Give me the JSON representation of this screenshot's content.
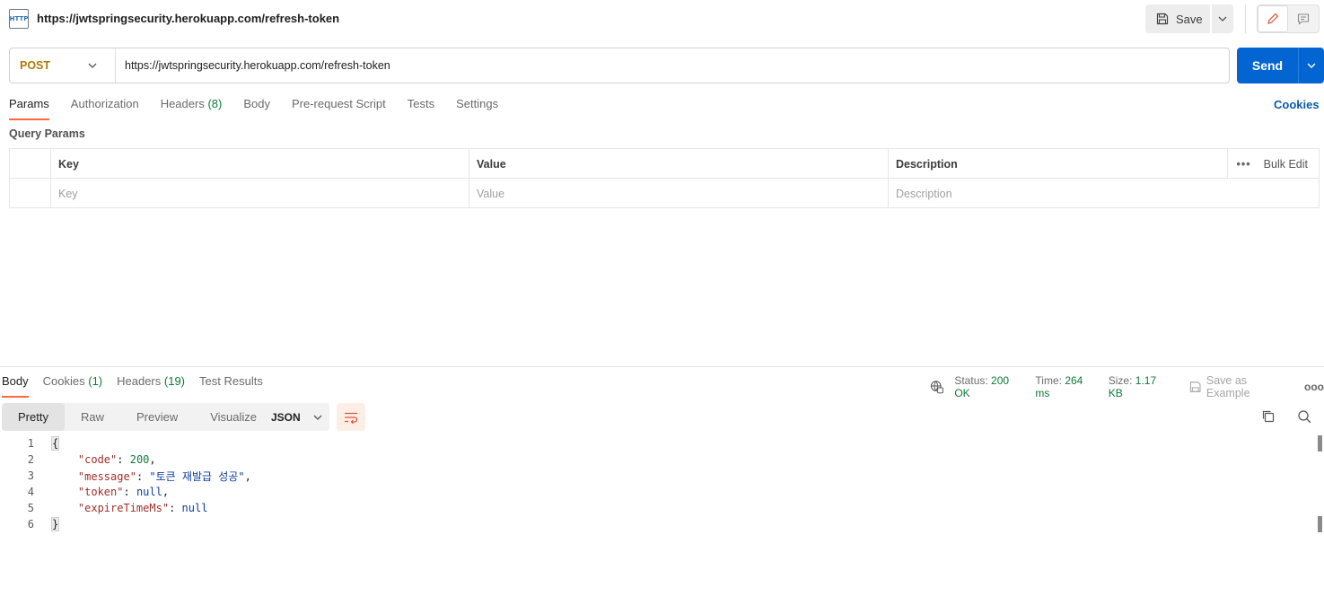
{
  "tab": {
    "title": "https://jwtspringsecurity.herokuapp.com/refresh-token",
    "icon": "http-icon"
  },
  "toolbar": {
    "save_label": "Save"
  },
  "request": {
    "method": "POST",
    "url": "https://jwtspringsecurity.herokuapp.com/refresh-token",
    "send_label": "Send"
  },
  "request_tabs": {
    "params": "Params",
    "authorization": "Authorization",
    "headers": "Headers",
    "headers_count": "(8)",
    "body": "Body",
    "pre_request": "Pre-request Script",
    "tests": "Tests",
    "settings": "Settings",
    "cookies": "Cookies"
  },
  "query_params": {
    "label": "Query Params",
    "columns": {
      "key": "Key",
      "value": "Value",
      "description": "Description"
    },
    "bulk_edit": "Bulk Edit",
    "placeholders": {
      "key": "Key",
      "value": "Value",
      "description": "Description"
    }
  },
  "response_tabs": {
    "body": "Body",
    "cookies": "Cookies",
    "cookies_count": "(1)",
    "headers": "Headers",
    "headers_count": "(19)",
    "test_results": "Test Results"
  },
  "response_meta": {
    "status_label": "Status:",
    "status_value": "200 OK",
    "time_label": "Time:",
    "time_value": "264 ms",
    "size_label": "Size:",
    "size_value": "1.17 KB",
    "save_example": "Save as Example"
  },
  "format": {
    "pretty": "Pretty",
    "raw": "Raw",
    "preview": "Preview",
    "visualize": "Visualize",
    "lang": "JSON"
  },
  "code": {
    "line_numbers": [
      "1",
      "2",
      "3",
      "4",
      "5",
      "6"
    ],
    "open_brace": "{",
    "close_brace": "}",
    "k_code": "\"code\"",
    "v_code": "200",
    "k_message": "\"message\"",
    "v_message": "\"토큰 재발급 성공\"",
    "k_token": "\"token\"",
    "v_token": "null",
    "k_expire": "\"expireTimeMs\"",
    "v_expire": "null"
  },
  "colors": {
    "accent_tab": "#ff6c37",
    "send_bg": "#0265d2",
    "method_post": "#ad7a03",
    "status_green": "#0f7b3a"
  }
}
